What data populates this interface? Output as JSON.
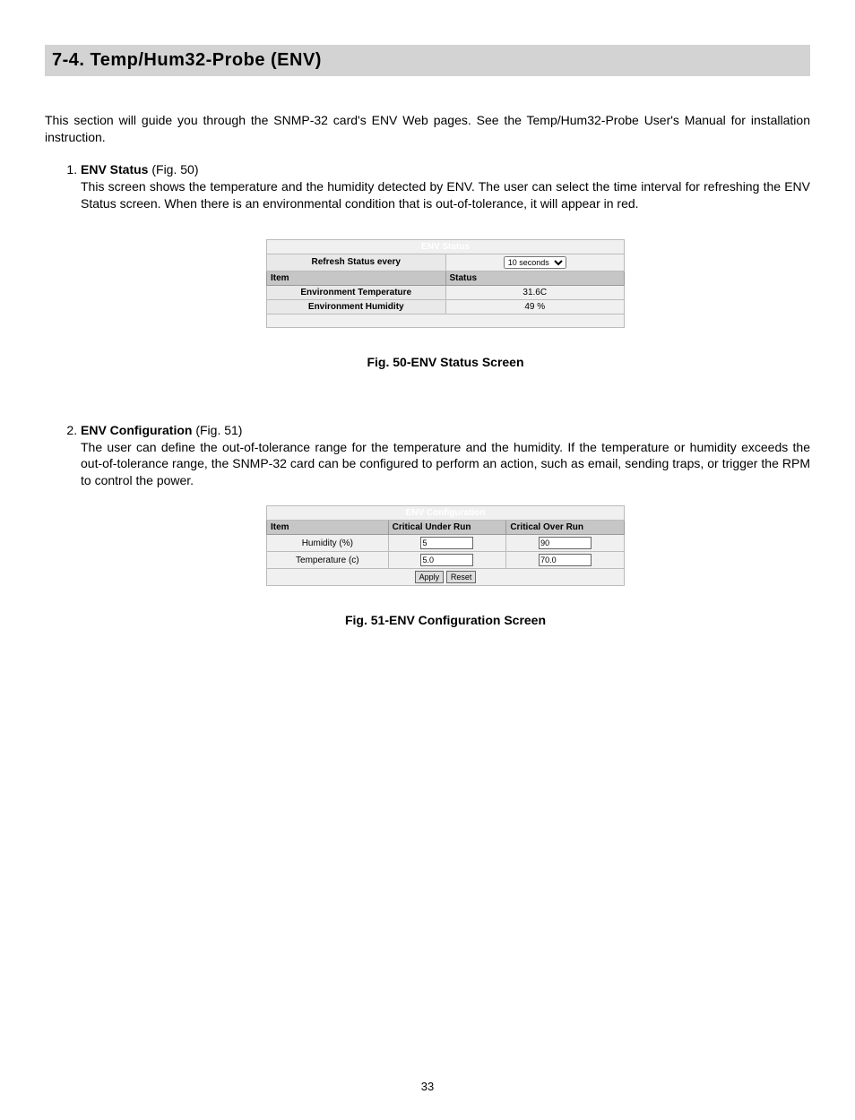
{
  "header": "7-4.  Temp/Hum32-Probe (ENV)",
  "intro": "This section will guide you through the SNMP-32 card's ENV Web pages.  See the Temp/Hum32-Probe User's Manual for installation instruction.",
  "item1": {
    "title_bold": "ENV Status",
    "title_ref": " (Fig. 50)",
    "body": "This screen shows the temperature and the humidity detected by ENV.  The user can select the time interval for refreshing the ENV Status screen.  When there is an environmental condition that is out-of-tolerance, it will appear in red.",
    "table": {
      "title": "ENV Status",
      "refresh_label": "Refresh Status every",
      "refresh_value": "10 seconds",
      "h_item": "Item",
      "h_status": "Status",
      "r1_item": "Environment Temperature",
      "r1_val": "31.6C",
      "r2_item": "Environment Humidity",
      "r2_val": "49 %"
    },
    "caption": "Fig. 50-ENV Status Screen"
  },
  "item2": {
    "title_bold": "ENV Configuration",
    "title_ref": " (Fig. 51)",
    "body": "The user can define the out-of-tolerance range for the temperature and the humidity.  If the temperature or humidity exceeds the out-of-tolerance range, the SNMP-32 card can be configured to perform an action, such as email, sending traps, or trigger the RPM to control the power.",
    "table": {
      "title": "ENV Configuration",
      "h_item": "Item",
      "h_under": "Critical Under Run",
      "h_over": "Critical Over Run",
      "r1_item": "Humidity (%)",
      "r1_under": "5",
      "r1_over": "90",
      "r2_item": "Temperature (c)",
      "r2_under": "5.0",
      "r2_over": "70.0",
      "btn_apply": "Apply",
      "btn_reset": "Reset"
    },
    "caption": "Fig. 51-ENV Configuration Screen"
  },
  "page_number": "33"
}
